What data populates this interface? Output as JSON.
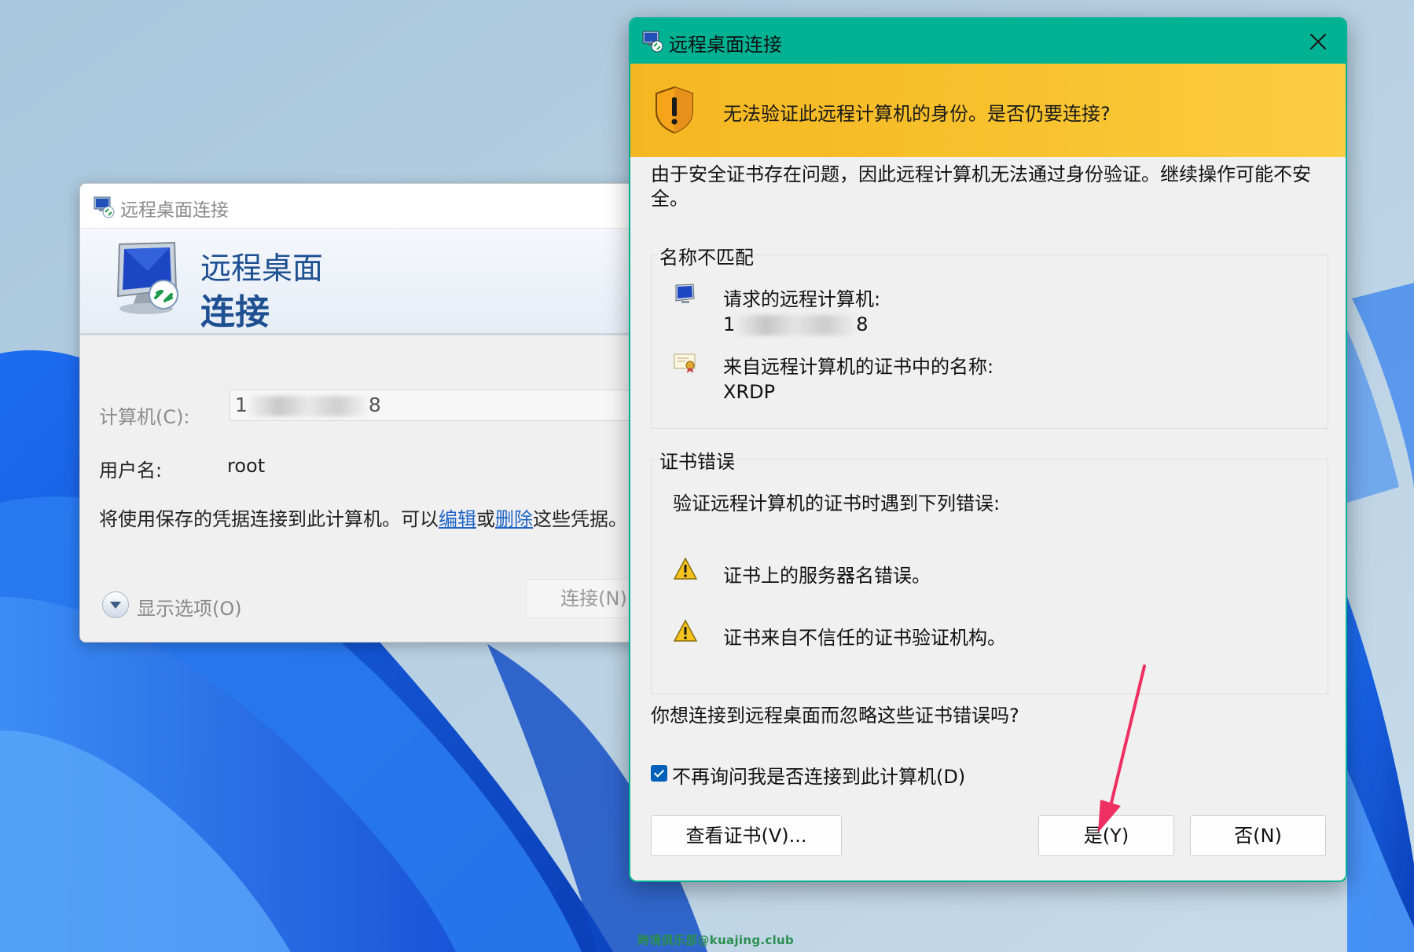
{
  "back_window": {
    "title": "远程桌面连接",
    "banner_line1": "远程桌面",
    "banner_line2": "连接",
    "computer_label": "计算机(C):",
    "computer_value_start": "1",
    "computer_value_end": "8",
    "username_label": "用户名:",
    "username_value": "root",
    "saved_text_before": "将使用保存的凭据连接到此计算机。可以",
    "edit_link": "编辑",
    "or_text": "或",
    "delete_link": "删除",
    "saved_text_after": "这些凭据。",
    "show_options": "显示选项(O)",
    "connect_button": "连接(N)"
  },
  "dialog": {
    "title": "远程桌面连接",
    "warning_headline": "无法验证此远程计算机的身份。是否仍要连接?",
    "intro": "由于安全证书存在问题，因此远程计算机无法通过身份验证。继续操作可能不安全。",
    "name_mismatch": {
      "legend": "名称不匹配",
      "requested_label": "请求的远程计算机:",
      "requested_value_start": "1",
      "requested_value_end": "8",
      "cert_name_label": "来自远程计算机的证书中的名称:",
      "cert_name_value": "XRDP"
    },
    "cert_errors": {
      "legend": "证书错误",
      "intro": "验证远程计算机的证书时遇到下列错误:",
      "errors": [
        "证书上的服务器名错误。",
        "证书来自不信任的证书验证机构。"
      ]
    },
    "question": "你想连接到远程桌面而忽略这些证书错误吗?",
    "dont_ask_checkbox": "不再询问我是否连接到此计算机(D)",
    "dont_ask_checked": true,
    "view_cert_button": "查看证书(V)...",
    "yes_button": "是(Y)",
    "no_button": "否(N)"
  },
  "watermark": "跨境俱乐部@kuajing.club",
  "colors": {
    "dialog_accent": "#00b294",
    "warning_band": "#f8c32f",
    "link": "#1f63c6",
    "annotation_arrow": "#ee2f62"
  },
  "icons": [
    "rdp-app-icon",
    "shield-warning-icon",
    "close-icon",
    "monitor-icon",
    "certificate-icon",
    "warning-triangle-icon",
    "chevron-down-icon"
  ]
}
